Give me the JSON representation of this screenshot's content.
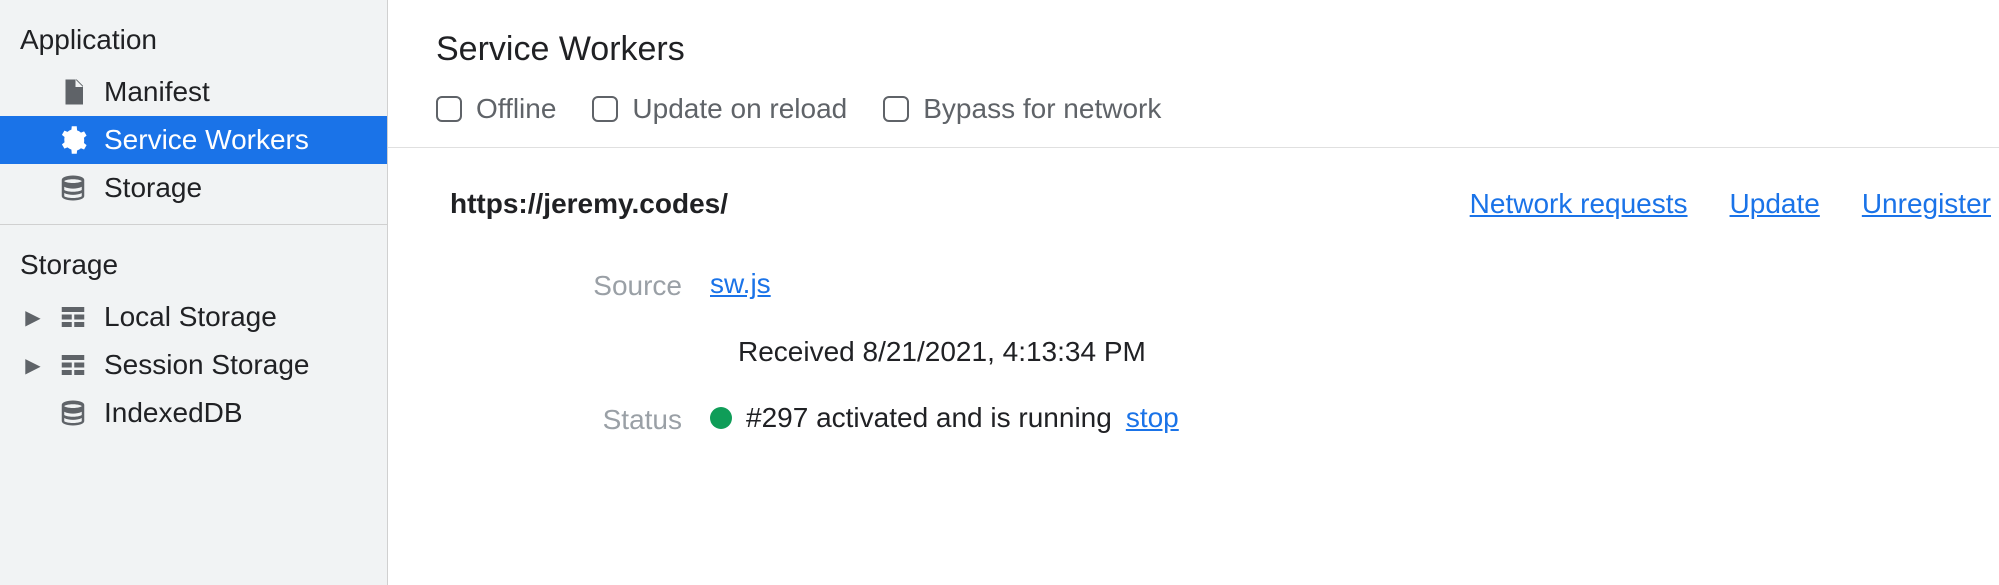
{
  "sidebar": {
    "section_application": "Application",
    "section_storage": "Storage",
    "items": {
      "manifest": "Manifest",
      "service_workers": "Service Workers",
      "storage": "Storage",
      "local_storage": "Local Storage",
      "session_storage": "Session Storage",
      "indexed_db": "IndexedDB"
    }
  },
  "main": {
    "title": "Service Workers",
    "checkboxes": {
      "offline": "Offline",
      "update_on_reload": "Update on reload",
      "bypass_for_network": "Bypass for network"
    },
    "origin": {
      "url": "https://jeremy.codes/",
      "links": {
        "network_requests": "Network requests",
        "update": "Update",
        "unregister": "Unregister"
      }
    },
    "details": {
      "source_label": "Source",
      "source_file": "sw.js",
      "received_text": "Received 8/21/2021, 4:13:34 PM",
      "status_label": "Status",
      "status_text": "#297 activated and is running",
      "stop_link": "stop"
    }
  }
}
